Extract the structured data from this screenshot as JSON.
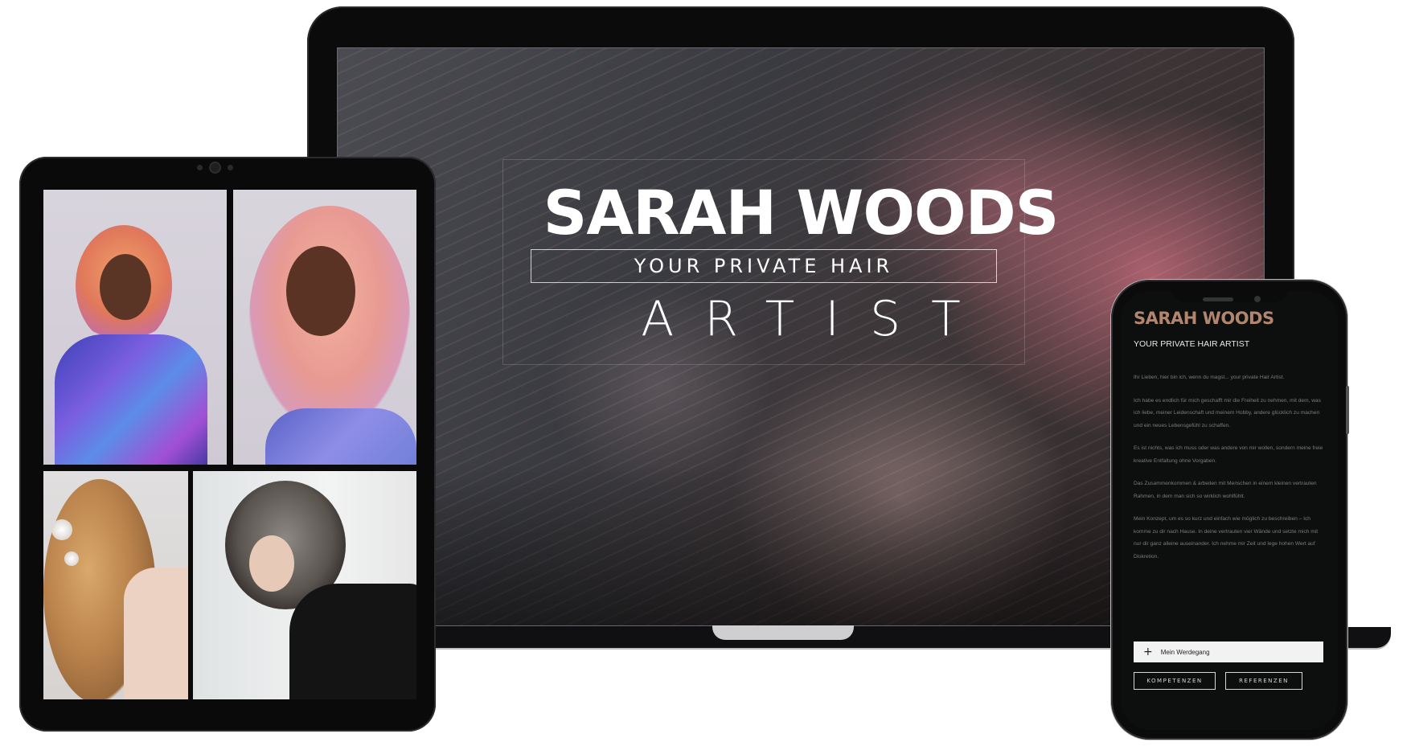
{
  "laptop": {
    "hero": {
      "title": "SARAH WOODS",
      "subtitle": "YOUR PRIVATE HAIR",
      "artist": "ARTIST"
    }
  },
  "tablet": {
    "gallery": [
      {
        "name": "gallery-photo-1"
      },
      {
        "name": "gallery-photo-2"
      },
      {
        "name": "gallery-photo-3"
      },
      {
        "name": "gallery-photo-4"
      }
    ]
  },
  "phone": {
    "title": "SARAH WOODS",
    "subtitle": "YOUR PRIVATE HAIR ARTIST",
    "paragraphs": [
      "Ihr Lieben, hier bin ich, wenn du magst... your private Hair Artist.",
      "Ich habe es endlich für mich geschafft mir die Freiheit zu nehmen, mit dem, was ich liebe, meiner Leidenschaft und meinem Hobby, andere glücklich zu machen und ein neues Lebensgefühl zu schaffen.",
      "Es ist nichts, was ich muss oder was andere von mir wollen, sondern meine freie kreative Entfaltung ohne Vorgaben.",
      "Das Zusammenkommen & arbeiten mit Menschen in einem kleinen vertrauten Rahmen, in dem man sich so wirklich wohlfühlt.",
      "Mein Konzept, um es so kurz und einfach wie möglich zu beschreiben – Ich komme zu dir nach Hause. In deine vertrauten vier Wände und setzte mich mit nur dir ganz alleine auseinander. Ich nehme mir Zeit und lege hohen Wert auf Diskretion."
    ],
    "accordion_label": "Mein Werdegang",
    "buttons": {
      "kompetenzen": "KOMPETENZEN",
      "referenzen": "REFERENZEN"
    }
  },
  "colors": {
    "accent": "#b2866e",
    "device_frame": "#0b0b0c",
    "phone_bg": "#0d0e0e"
  }
}
